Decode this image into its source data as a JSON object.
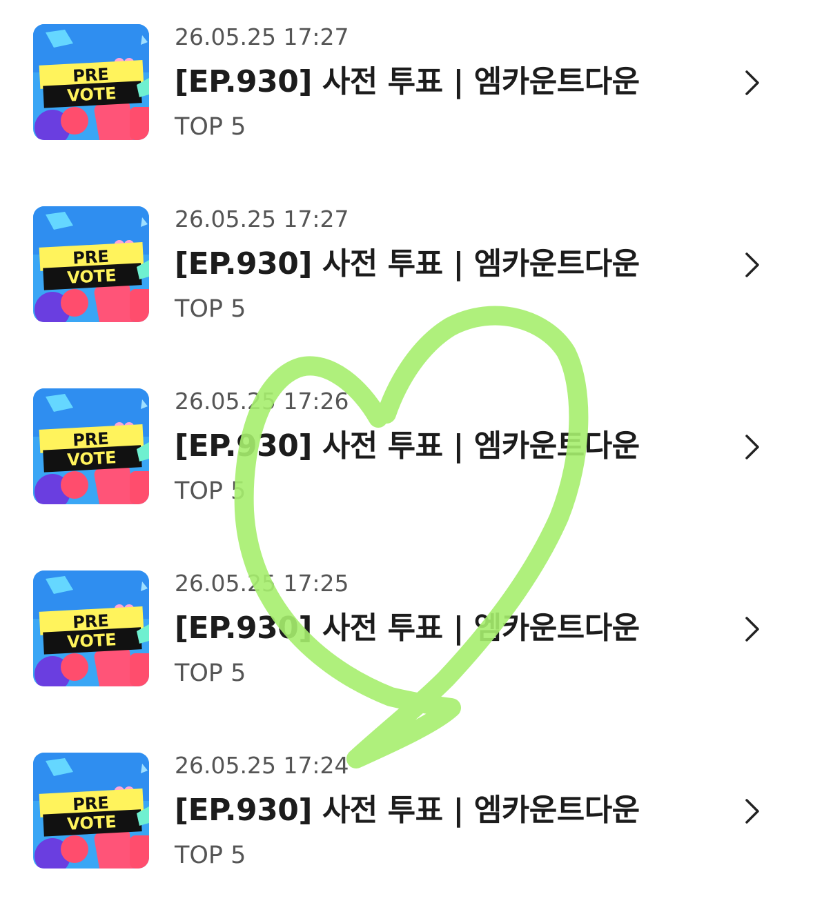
{
  "items": [
    {
      "date": "26.05.25 17:27",
      "title": "[EP.930] 사전 투표 | 엠카운트다운",
      "subtitle": "TOP 5",
      "thumb_line1": "PRE",
      "thumb_line2": "VOTE"
    },
    {
      "date": "26.05.25 17:27",
      "title": "[EP.930] 사전 투표 | 엠카운트다운",
      "subtitle": "TOP 5",
      "thumb_line1": "PRE",
      "thumb_line2": "VOTE"
    },
    {
      "date": "26.05.25 17:26",
      "title": "[EP.930] 사전 투표 | 엠카운트다운",
      "subtitle": "TOP 5",
      "thumb_line1": "PRE",
      "thumb_line2": "VOTE"
    },
    {
      "date": "26.05.25 17:25",
      "title": "[EP.930] 사전 투표 | 엠카운트다운",
      "subtitle": "TOP 5",
      "thumb_line1": "PRE",
      "thumb_line2": "VOTE"
    },
    {
      "date": "26.05.25 17:24",
      "title": "[EP.930] 사전 투표 | 엠카운트다운",
      "subtitle": "TOP 5",
      "thumb_line1": "PRE",
      "thumb_line2": "VOTE"
    }
  ],
  "icons": {
    "row_arrow": "chevron-right-icon",
    "thumbnail": "pre-vote-thumbnail",
    "overlay": "heart-doodle"
  },
  "colors": {
    "title": "#1c1c1c",
    "meta": "#555555",
    "heart": "#a6ee6e",
    "thumb_bg": "#3aa6f5",
    "thumb_banner": "#fff35c"
  }
}
